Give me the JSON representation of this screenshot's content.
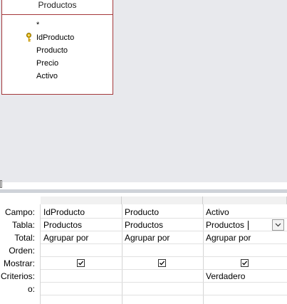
{
  "table": {
    "title": "Productos",
    "fields": [
      "*",
      "IdProducto",
      "Producto",
      "Precio",
      "Activo"
    ]
  },
  "grid": {
    "row_labels": [
      "Campo:",
      "Tabla:",
      "Total:",
      "Orden:",
      "Mostrar:",
      "Criterios:",
      "o:"
    ],
    "columns": [
      {
        "campo": "IdProducto",
        "tabla": "Productos",
        "total": "Agrupar por",
        "orden": "",
        "mostrar": true,
        "criterios": "",
        "o": ""
      },
      {
        "campo": "Producto",
        "tabla": "Productos",
        "total": "Agrupar por",
        "orden": "",
        "mostrar": true,
        "criterios": "",
        "o": ""
      },
      {
        "campo": "Activo",
        "tabla": "Productos",
        "total": "Agrupar por",
        "orden": "",
        "mostrar": true,
        "criterios": "Verdadero",
        "o": ""
      }
    ]
  },
  "icons": {
    "key": "primary-key-icon",
    "dropdown": "chevron-down-icon",
    "check": "checkmark-icon"
  },
  "colors": {
    "table_border": "#a4373a",
    "pane_bg": "#e8e9ed",
    "splitter": "#cfd3d9"
  }
}
